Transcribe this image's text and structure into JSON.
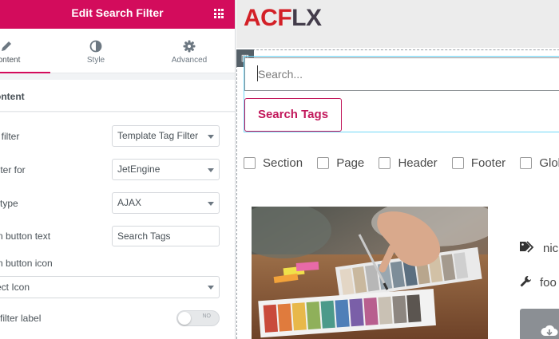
{
  "editor": {
    "title": "Edit Search Filter",
    "tabs": [
      {
        "label": "ontent"
      },
      {
        "label": "Style"
      },
      {
        "label": "Advanced"
      }
    ],
    "section_title": "ontent",
    "controls": {
      "filter_label": "t filter",
      "filter_value": "Template Tag Filter",
      "filter_for_label": "ilter for",
      "filter_for_value": "JetEngine",
      "type_label": "type",
      "type_value": "AJAX",
      "button_text_label": "n button text",
      "button_text_value": "Search Tags",
      "button_icon_label": "n button icon",
      "icon_select_value": "ect Icon",
      "filter_label_toggle_label": "filter label",
      "toggle_state": "NO"
    }
  },
  "preview": {
    "logo_part1": "ACF",
    "logo_part2": "LX",
    "search_placeholder": "Search...",
    "search_button": "Search Tags",
    "checkboxes": [
      "Section",
      "Page",
      "Header",
      "Footer",
      "Globa"
    ],
    "meta_tag": "nic",
    "meta_tool": "foo"
  },
  "colors": {
    "accent": "#d30c5c",
    "button_text": "#c2185b",
    "logo_red": "#d32027",
    "logo_dark": "#433c4a"
  },
  "icons": {
    "grid": "grid-icon",
    "content_tab": "pencil-icon",
    "style_tab": "contrast-icon",
    "advanced_tab": "gear-icon",
    "collapse": "chevron-left-icon",
    "widget": "column-icon",
    "tag": "tag-icon",
    "wrench": "wrench-icon",
    "download": "download-icon"
  }
}
